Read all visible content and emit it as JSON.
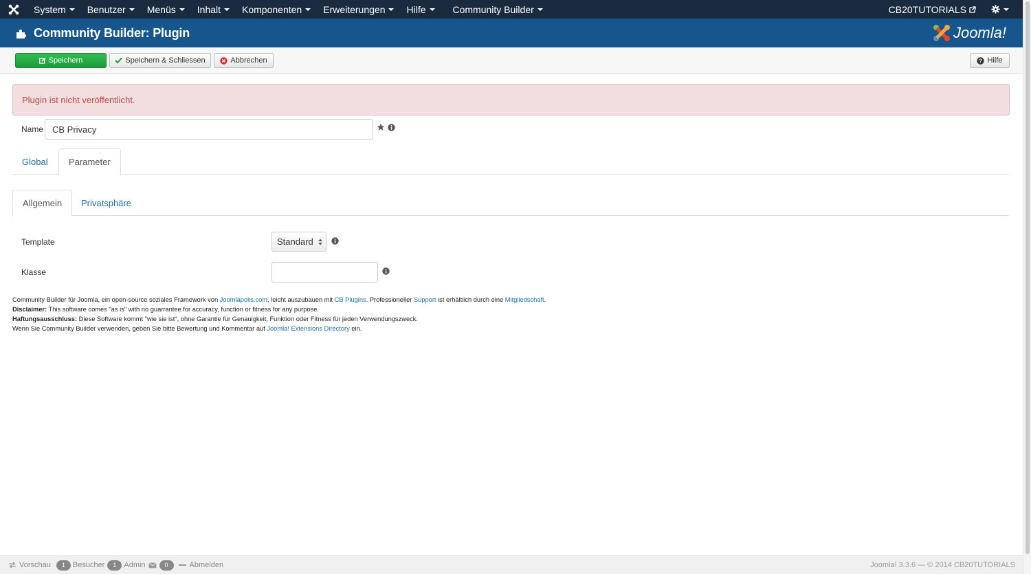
{
  "topnav": {
    "menu": [
      "System",
      "Benutzer",
      "Menüs",
      "Inhalt",
      "Komponenten",
      "Erweiterungen",
      "Hilfe",
      "Community Builder"
    ],
    "site_link": "CB20TUTORIALS"
  },
  "header": {
    "title": "Community Builder: Plugin",
    "logo_text": "Joomla!"
  },
  "toolbar": {
    "save_label": "Speichern",
    "save_close_label": "Speichern & Schliessen",
    "cancel_label": "Abbrechen",
    "help_label": "Hilfe"
  },
  "alert": {
    "message": "Plugin ist nicht veröffentlicht."
  },
  "form": {
    "name_label": "Name",
    "name_value": "CB Privacy",
    "template_label": "Template",
    "template_value": "Standard",
    "klasse_label": "Klasse",
    "klasse_value": ""
  },
  "tabs": {
    "global": "Global",
    "parameter": "Parameter"
  },
  "subtabs": {
    "allgemein": "Allgemein",
    "privatsphaere": "Privatsphäre"
  },
  "footer": {
    "line1_a": "Community Builder für Joomla, ein open-source soziales Framework von ",
    "line1_link1": "Joomlapolis.com",
    "line1_b": ", leicht auszubauen mit ",
    "line1_link2": "CB Plugins",
    "line1_c": ". Professioneller ",
    "line1_link3": "Support",
    "line1_d": " ist erhältlich durch eine ",
    "line1_link4": "Mitgliedschaft",
    "line1_e": ".",
    "line2_bold": "Disclaimer:",
    "line2_text": " This software comes \"as is\" with no guarrantee for accuracy, function or fitness for any purpose.",
    "line3_bold": "Haftungsausschluss:",
    "line3_text": " Diese Software kommt \"wie sie ist\", ohne Garantie für Genauigkeit, Funktion oder Fitness für jeden Verwendungszweck.",
    "line4_a": "Wenn Sie Community Builder verwenden, geben Sie bitte Bewertung und Kommentar auf ",
    "line4_link": "Joomla! Extensions Directory",
    "line4_b": " ein."
  },
  "statusbar": {
    "preview": "Vorschau",
    "visitors_count": "1",
    "visitors_label": "Besucher",
    "admin_count": "1",
    "admin_label": "Admin",
    "messages_count": "0",
    "logout": "Abmelden",
    "version_info": "Joomla! 3.3.6  —  © 2014 CB20TUTORIALS"
  },
  "colors": {
    "topnav_bg": "#1b2b3f",
    "header_bg": "#17568c",
    "save_green": "#24a943",
    "alert_bg": "#f2dede",
    "alert_text": "#b94a48",
    "link": "#1f6ea8"
  }
}
